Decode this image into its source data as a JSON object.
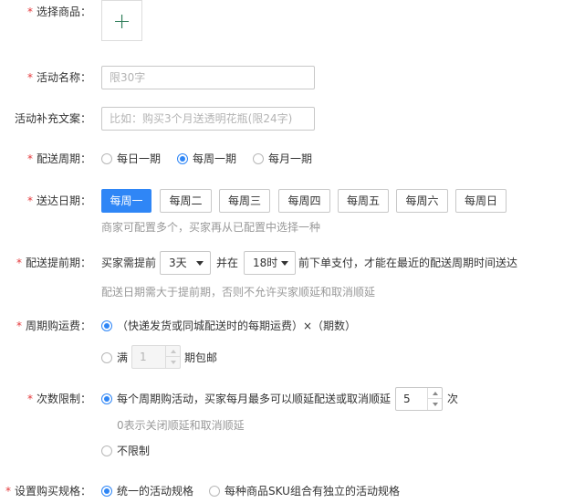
{
  "product": {
    "label": "选择商品：",
    "add_icon": "plus-icon",
    "add_symbol": "+"
  },
  "name": {
    "label": "活动名称：",
    "placeholder": "限30字",
    "value": ""
  },
  "supplement": {
    "label": "活动补充文案：",
    "placeholder": "比如：购买3个月送透明花瓶(限24字)",
    "value": ""
  },
  "cycle": {
    "label": "配送周期：",
    "options": [
      "每日一期",
      "每周一期",
      "每月一期"
    ],
    "selected": "每周一期"
  },
  "delivery_day": {
    "label": "送达日期：",
    "days": [
      "每周一",
      "每周二",
      "每周三",
      "每周四",
      "每周五",
      "每周六",
      "每周日"
    ],
    "selected": "每周一",
    "hint": "商家可配置多个，买家再从已配置中选择一种"
  },
  "advance": {
    "label": "配送提前期：",
    "prefix": "买家需提前",
    "days_value": "3天",
    "mid": "并在",
    "time_value": "18时",
    "suffix": "前下单支付，才能在最近的配送周期时间送达",
    "hint": "配送日期需大于提前期，否则不允许买家顺延和取消顺延"
  },
  "shipping": {
    "label": "周期购运费：",
    "option1": "（快递发货或同城配送时的每期运费）×（期数）",
    "option2_prefix": "满",
    "option2_value": "1",
    "option2_suffix": "期包邮",
    "selected": "option1"
  },
  "limit": {
    "label": "次数限制：",
    "option1_prefix": "每个周期购活动，买家每月最多可以顺延配送或取消顺延",
    "option1_value": "5",
    "option1_suffix": "次",
    "hint": "0表示关闭顺延和取消顺延",
    "option2": "不限制",
    "selected": "option1"
  },
  "spec": {
    "label": "设置购买规格：",
    "options": [
      "统一的活动规格",
      "每种商品SKU组合有独立的活动规格"
    ],
    "selected": "统一的活动规格"
  },
  "colors": {
    "accent": "#2f86f6",
    "required": "#e4393c",
    "hint": "#999999"
  }
}
